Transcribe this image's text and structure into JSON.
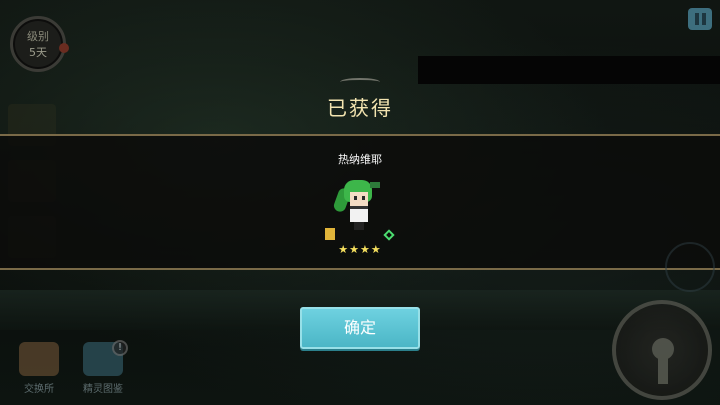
{
  "hud": {
    "day_label": "级别",
    "day_value": "5天"
  },
  "modal": {
    "title": "已获得",
    "character_name": "热纳维耶",
    "stars": "★★★★",
    "confirm_label": "确定"
  },
  "bottom_menu": {
    "exchange_label": "交换所",
    "collection_label": "精灵图鉴",
    "alert_mark": "!"
  },
  "colors": {
    "accent": "#4bb6c6",
    "title_gold": "#f3e4b0",
    "star_yellow": "#f6e05e",
    "band_border": "#7a6a48"
  }
}
